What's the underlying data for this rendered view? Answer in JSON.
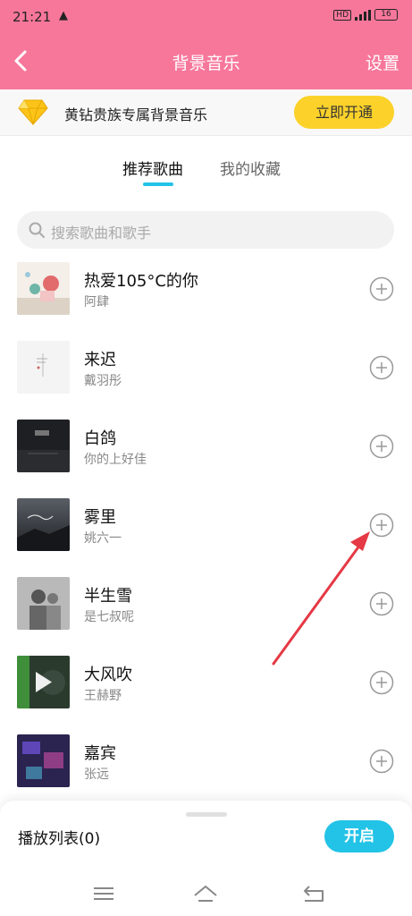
{
  "status_bar": {
    "time": "21:21",
    "left_icon": "navigation-icon",
    "battery": "16",
    "network": "HD"
  },
  "header": {
    "title": "背景音乐",
    "settings": "设置",
    "background": "#f7779b"
  },
  "vip_banner": {
    "text": "黄钻贵族专属背景音乐",
    "button": "立即开通",
    "button_color": "#fcd22a"
  },
  "tabs": [
    {
      "label": "推荐歌曲",
      "active": true
    },
    {
      "label": "我的收藏",
      "active": false
    }
  ],
  "search": {
    "placeholder": "搜索歌曲和歌手"
  },
  "songs": [
    {
      "title": "热爱105°C的你",
      "artist": "阿肆"
    },
    {
      "title": "来迟",
      "artist": "戴羽彤"
    },
    {
      "title": "白鸽",
      "artist": "你的上好佳"
    },
    {
      "title": "雾里",
      "artist": "姚六一"
    },
    {
      "title": "半生雪",
      "artist": "是七叔呢"
    },
    {
      "title": "大风吹",
      "artist": "王赫野"
    },
    {
      "title": "嘉宾",
      "artist": "张远"
    }
  ],
  "bottom_sheet": {
    "playlist_label": "播放列表(0)",
    "start_button": "开启"
  },
  "accent_color": "#22c3e6"
}
